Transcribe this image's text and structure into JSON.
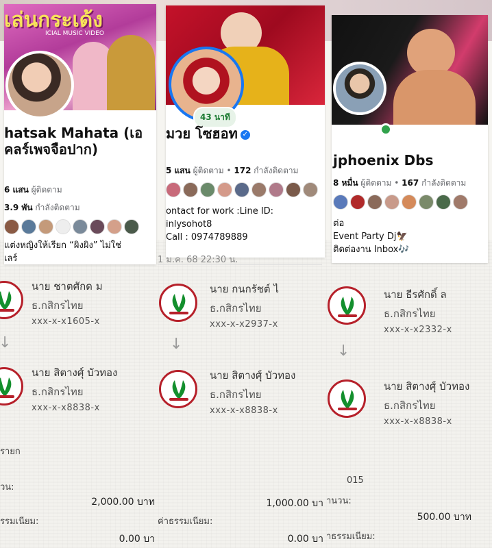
{
  "panels": [
    {
      "profile": {
        "name": "hatsak Mahata (เอ คลร์เพจจือปาก)",
        "followers_count": "6 แสน",
        "followers_label": "ผู้ติดตาม",
        "following_count": "3.9 พัน",
        "following_label": "กำลังติดตาม",
        "bio": [
          "แต่งหญิงให้เรียก “ผิงผิง” ไม่ใช่",
          "เลร์"
        ],
        "cover_text": "เล่นกระเด้ง",
        "cover_subtext": "ICIAL MUSIC VIDEO"
      },
      "slip": {
        "time_line": "",
        "sender_name": "นาย ชาตศักด ม",
        "sender_bank": "ธ.กสิกรไทย",
        "sender_account": "xxx-x-x1605-x",
        "receiver_name": "นาย สิตางศุ์ บัวทอง",
        "receiver_bank": "ธ.กสิกรไทย",
        "receiver_account": "xxx-x-x8838-x",
        "ref_label": "รายก",
        "amount_label": "วน:",
        "amount": "2,000.00 บาท",
        "fee_label": "รรมเนียม:",
        "fee": "0.00 บา"
      }
    },
    {
      "profile": {
        "name": "มวย โซฮอท",
        "followers_count": "5 แสน",
        "followers_label": "ผู้ติดตาม",
        "following_count": "172",
        "following_label": "กำลังติดตาม",
        "story_badge": "43 นาที",
        "bio": [
          "ontact for work :Line ID:",
          "inlysohot8",
          "Call : 0974789889"
        ]
      },
      "slip": {
        "time_line": "1 ม.ค. 68 22:30 น.",
        "sender_name": "นาย กนกรัชต์ ไ",
        "sender_bank": "ธ.กสิกรไทย",
        "sender_account": "xxx-x-x2937-x",
        "receiver_name": "นาย สิตางศุ์ บัวทอง",
        "receiver_bank": "ธ.กสิกรไทย",
        "receiver_account": "xxx-x-x8838-x",
        "amount": "1,000.00 บา",
        "fee_label": "ค่าธรรมเนียม:",
        "fee": "0.00 บา"
      }
    },
    {
      "profile": {
        "name": "jphoenix Dbs",
        "followers_count": "8 หมื่น",
        "followers_label": "ผู้ติดตาม",
        "following_count": "167",
        "following_label": "กำลังติดตาม",
        "bio": [
          "ต่อ",
          "Event Party Dj🦅",
          "ติดต่องาน Inbox🎶"
        ]
      },
      "slip": {
        "sender_name": "นาย ธีรศักดิ์ ล",
        "sender_bank": "ธ.กสิกรไทย",
        "sender_account": "xxx-x-x2332-x",
        "receiver_name": "นาย สิตางศุ์ บัวทอง",
        "receiver_bank": "ธ.กสิกรไทย",
        "receiver_account": "xxx-x-x8838-x",
        "ref_fragment": "015",
        "amount_label": "านวน:",
        "amount": "500.00 บาท",
        "fee_label": "าธรรมเนียม:"
      }
    }
  ],
  "colors": {
    "kbank_green": "#138f2d",
    "kbank_red": "#b6202a",
    "facebook_blue": "#1877f2",
    "online_green": "#31a24c"
  }
}
